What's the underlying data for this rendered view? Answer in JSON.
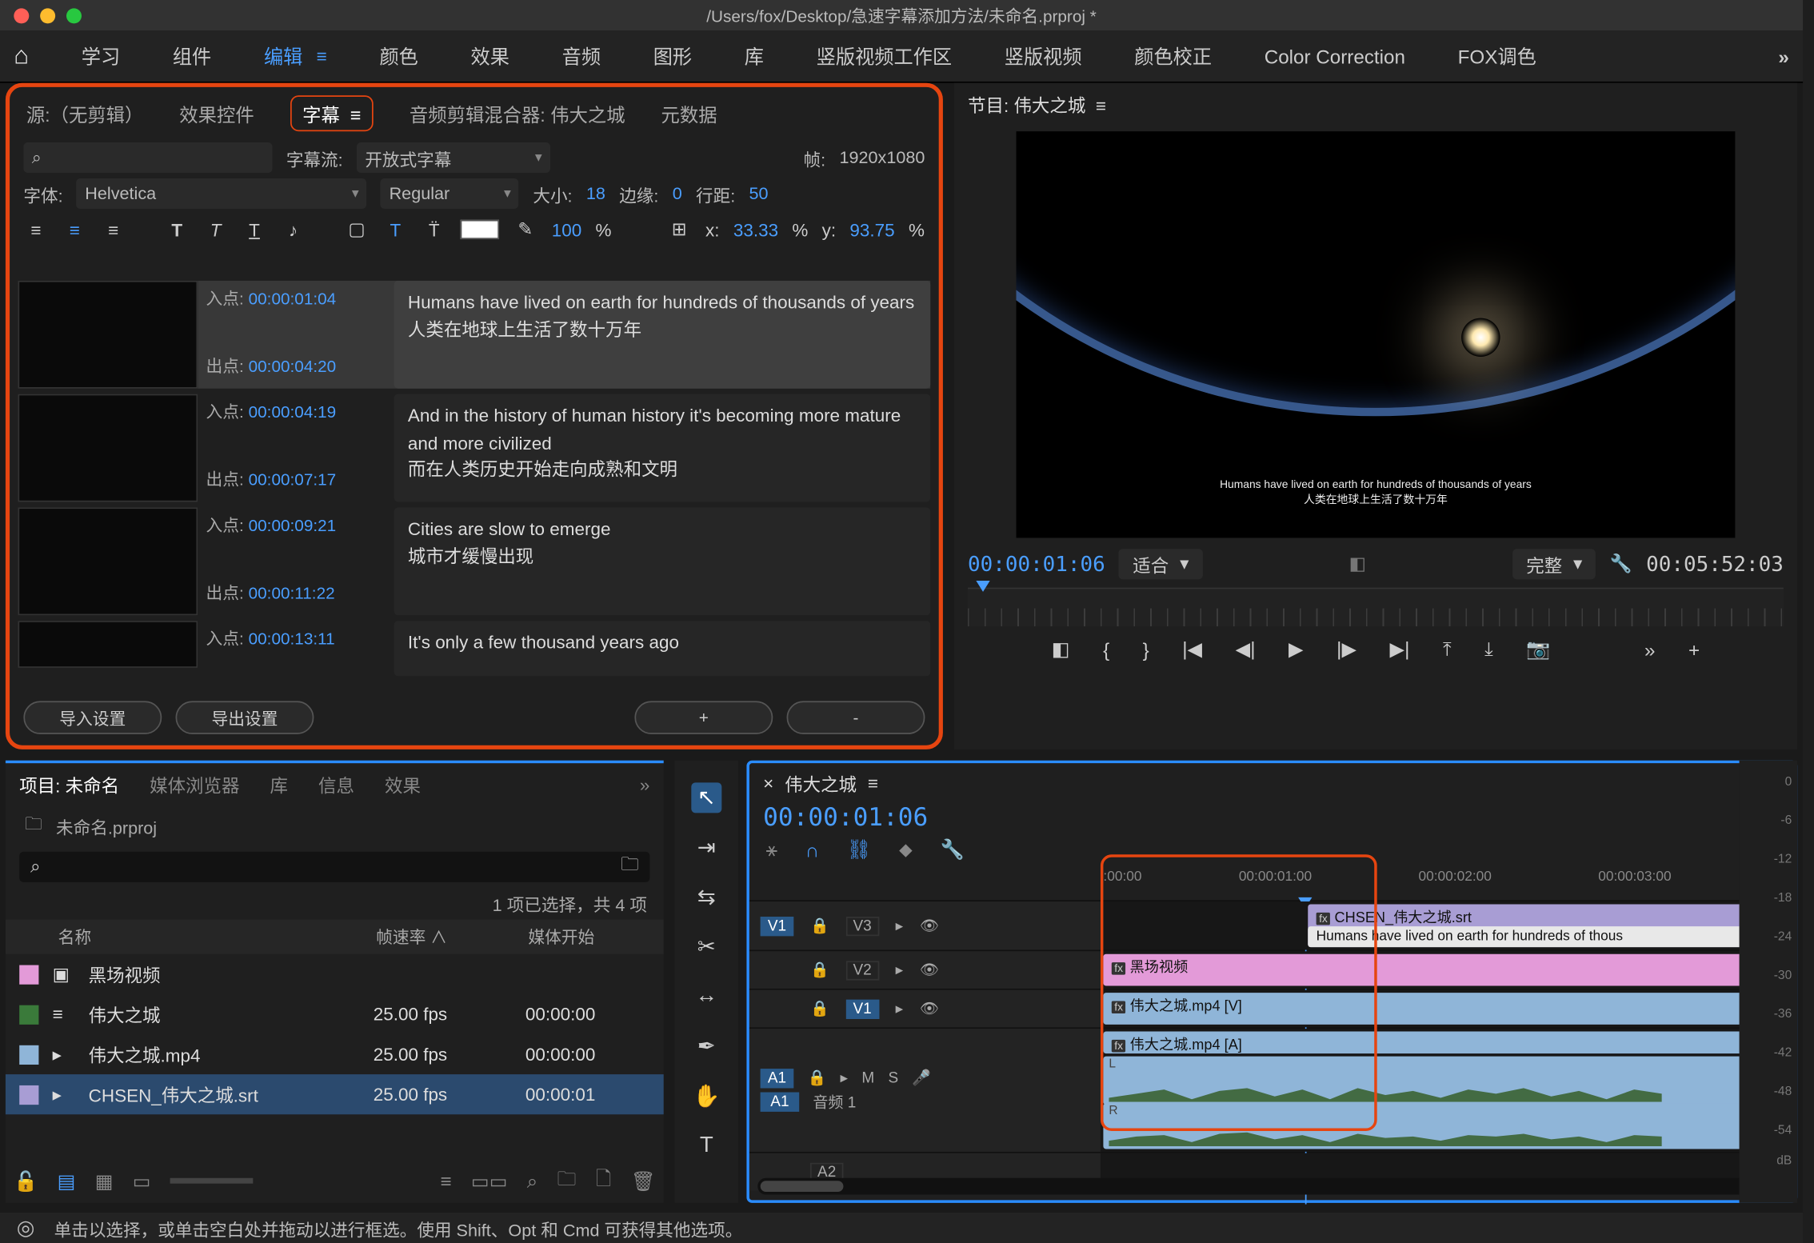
{
  "title": "/Users/fox/Desktop/急速字幕添加方法/未命名.prproj *",
  "workspaces": {
    "items": [
      "学习",
      "组件",
      "编辑",
      "颜色",
      "效果",
      "音频",
      "图形",
      "库",
      "竖版视频工作区",
      "竖版视频",
      "颜色校正",
      "Color Correction",
      "FOX调色"
    ],
    "active_index": 2
  },
  "captions": {
    "tabs": {
      "source": "源:（无剪辑）",
      "effects": "效果控件",
      "captions": "字幕",
      "mixer": "音频剪辑混合器: 伟大之城",
      "metadata": "元数据"
    },
    "stream_label": "字幕流:",
    "stream_value": "开放式字幕",
    "frame_label": "帧:",
    "frame_value": "1920x1080",
    "font_label": "字体:",
    "font_value": "Helvetica",
    "weight_value": "Regular",
    "size_label": "大小:",
    "size_value": "18",
    "edge_label": "边缘:",
    "edge_value": "0",
    "leading_label": "行距:",
    "leading_value": "50",
    "opacity": "100",
    "opacity_unit": "%",
    "x_label": "x:",
    "x_value": "33.33",
    "y_label": "y:",
    "y_value": "93.75",
    "pct": "%",
    "in_label": "入点:",
    "out_label": "出点:",
    "items": [
      {
        "in": "00:00:01:04",
        "out": "00:00:04:20",
        "en": "Humans have lived on earth for hundreds of thousands of years",
        "zh": "人类在地球上生活了数十万年"
      },
      {
        "in": "00:00:04:19",
        "out": "00:00:07:17",
        "en": "And in the history of human history it's becoming more mature and more civilized",
        "zh": "而在人类历史开始走向成熟和文明"
      },
      {
        "in": "00:00:09:21",
        "out": "00:00:11:22",
        "en": "Cities are slow to emerge",
        "zh": "城市才缓慢出现"
      },
      {
        "in": "00:00:13:11",
        "out": "",
        "en": "It's only a few thousand years ago",
        "zh": ""
      }
    ],
    "import_btn": "导入设置",
    "export_btn": "导出设置",
    "add_btn": "+",
    "del_btn": "-"
  },
  "program": {
    "title": "节目: 伟大之城",
    "menu": "≡",
    "sub_en": "Humans have lived on earth for hundreds of thousands of years",
    "sub_zh": "人类在地球上生活了数十万年",
    "timecode": "00:00:01:06",
    "fit_label": "适合",
    "quality_label": "完整",
    "duration": "00:05:52:03"
  },
  "project": {
    "tabs": [
      "项目: 未命名",
      "媒体浏览器",
      "库",
      "信息",
      "效果"
    ],
    "crumb": "未命名.prproj",
    "search_placeholder": "",
    "status": "1 项已选择，共 4 项",
    "cols": {
      "name": "名称",
      "fps": "帧速率",
      "start": "媒体开始"
    },
    "rows": [
      {
        "color": "#e39ad8",
        "icon": "▣",
        "name": "黑场视频",
        "fps": "",
        "start": ""
      },
      {
        "color": "#3a7a3a",
        "icon": "≡",
        "name": "伟大之城",
        "fps": "25.00 fps",
        "start": "00:00:00"
      },
      {
        "color": "#8fb5d8",
        "icon": "▸",
        "name": "伟大之城.mp4",
        "fps": "25.00 fps",
        "start": "00:00:00"
      },
      {
        "color": "#a89dd4",
        "icon": "▸",
        "name": "CHSEN_伟大之城.srt",
        "fps": "25.00 fps",
        "start": "00:00:01"
      }
    ],
    "selected_index": 3
  },
  "timeline": {
    "seq_name": "伟大之城",
    "menu": "≡",
    "timecode": "00:00:01:06",
    "ruler": [
      ":00:00",
      "00:00:01:00",
      "00:00:02:00",
      "00:00:03:00"
    ],
    "tracks": {
      "v3": {
        "src": "V1",
        "name": "V3",
        "clip_srt": "CHSEN_伟大之城.srt",
        "clip_txt": "Humans have lived on earth for hundreds of thous"
      },
      "v2": {
        "name": "V2",
        "clip": "黑场视频"
      },
      "v1": {
        "name": "V1",
        "clip": "伟大之城.mp4 [V]"
      },
      "a1": {
        "src": "A1",
        "name": "音频 1",
        "clip": "伟大之城.mp4 [A]",
        "mute": "M",
        "solo": "S"
      },
      "a2": {
        "name": "A2"
      }
    }
  },
  "status_bar": "单击以选择，或单击空白处并拖动以进行框选。使用 Shift、Opt 和 Cmd 可获得其他选项。",
  "meters": {
    "scale": [
      "0",
      "-6",
      "-12",
      "-18",
      "-24",
      "-30",
      "-36",
      "-42",
      "-48",
      "-54",
      "dB"
    ]
  }
}
